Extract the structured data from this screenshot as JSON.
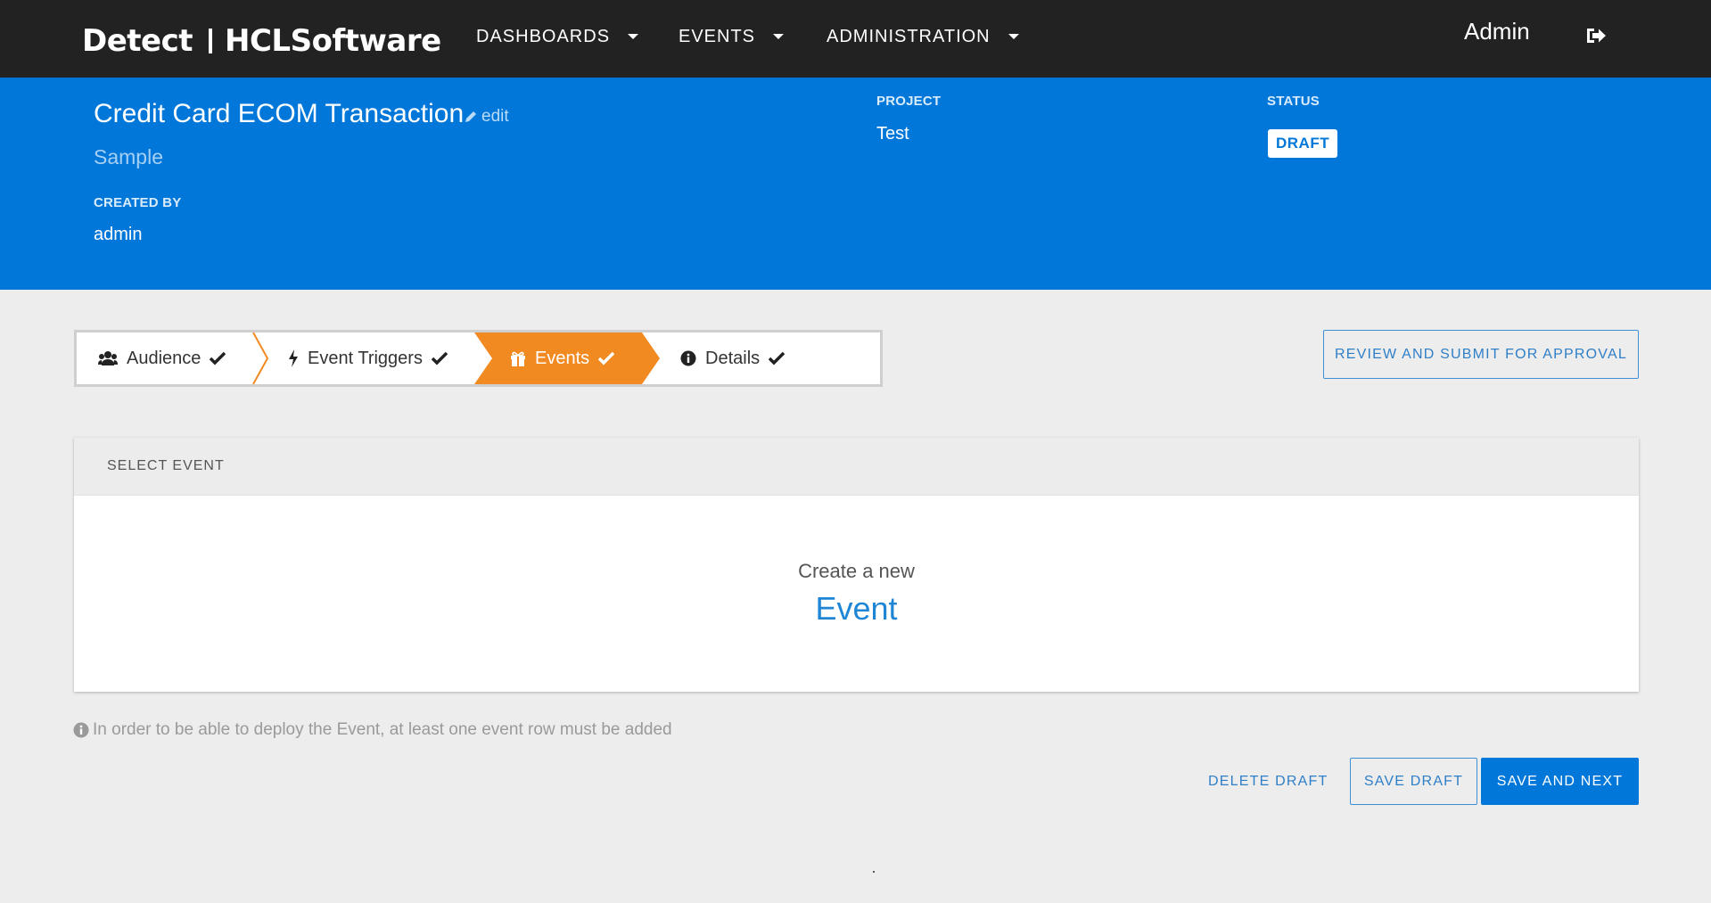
{
  "nav": {
    "brand_left": "Detect",
    "brand_right": "HCLSoftware",
    "items": [
      {
        "label": "DASHBOARDS"
      },
      {
        "label": "EVENTS"
      },
      {
        "label": "ADMINISTRATION"
      }
    ],
    "user": "Admin",
    "logout_icon": "sign-out-icon"
  },
  "header": {
    "title": "Credit Card ECOM Transaction",
    "edit_label": "edit",
    "subtitle": "Sample",
    "created_by_label": "CREATED BY",
    "created_by_value": "admin",
    "project_label": "PROJECT",
    "project_value": "Test",
    "status_label": "STATUS",
    "status_value": "DRAFT"
  },
  "stepper": {
    "steps": [
      {
        "label": "Audience",
        "icon": "users-icon",
        "completed": true,
        "active": false
      },
      {
        "label": "Event Triggers",
        "icon": "bolt-icon",
        "completed": true,
        "active": false
      },
      {
        "label": "Events",
        "icon": "gift-icon",
        "completed": true,
        "active": true
      },
      {
        "label": "Details",
        "icon": "info-icon",
        "completed": true,
        "active": false
      }
    ]
  },
  "review_button": "REVIEW AND SUBMIT FOR APPROVAL",
  "panel": {
    "header": "SELECT EVENT",
    "create_text": "Create a new",
    "create_link": "Event"
  },
  "info_note": "In order to be able to deploy the Event, at least one event row must be added",
  "actions": {
    "delete": "DELETE DRAFT",
    "save_draft": "SAVE DRAFT",
    "save_next": "SAVE AND NEXT"
  },
  "colors": {
    "topbar": "#222222",
    "header_blue": "#0077d9",
    "active_step": "#f28a22",
    "link_blue": "#1f86d6"
  }
}
